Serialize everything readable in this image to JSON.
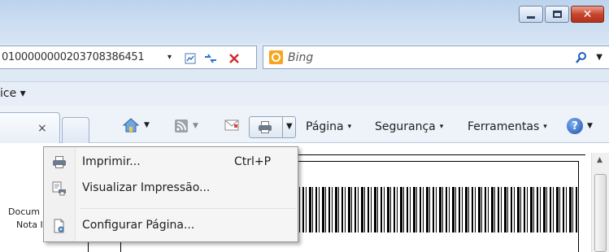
{
  "address": {
    "url": "0100000000203708386451",
    "dropdown": "▾"
  },
  "search": {
    "placeholder": "Bing"
  },
  "favorites_row": {
    "text": "ice ▾"
  },
  "tab": {
    "close": "×"
  },
  "toolbar": {
    "pagina": "Página",
    "seguranca": "Segurança",
    "ferramentas": "Ferramentas",
    "arrow": "▾"
  },
  "menu": {
    "items": [
      {
        "label": "Imprimir...",
        "shortcut": "Ctrl+P",
        "icon": "printer-icon"
      },
      {
        "label": "Visualizar Impressão...",
        "shortcut": "",
        "icon": "print-preview-icon"
      },
      {
        "label": "Configurar Página...",
        "shortcut": "",
        "icon": "page-setup-icon"
      }
    ]
  },
  "document": {
    "big": "D",
    "line1": "Docum",
    "line2": "Nota I"
  },
  "colors": {
    "accent": "#1c4fa8",
    "close": "#c8452c",
    "bing": "#f7a51c"
  }
}
